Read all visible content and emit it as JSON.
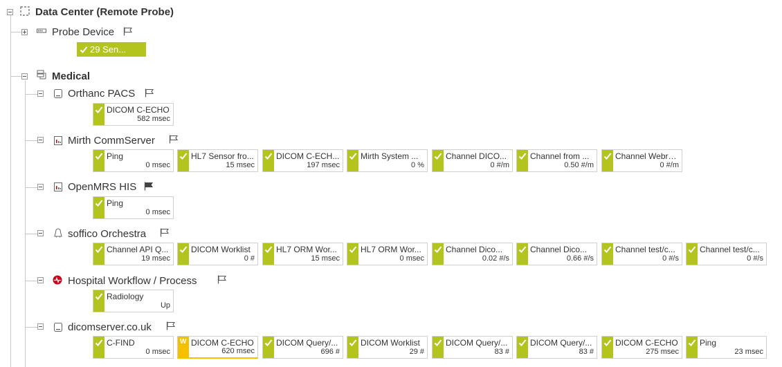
{
  "root": {
    "label": "Data Center (Remote Probe)"
  },
  "probe": {
    "label": "Probe Device",
    "summary": "29 Sen..."
  },
  "group": {
    "label": "Medical"
  },
  "devices": [
    {
      "label": "Orthanc PACS",
      "sensors": [
        {
          "name": "DICOM C-ECHO",
          "value": "582 msec",
          "status": "ok"
        }
      ]
    },
    {
      "label": "Mirth CommServer",
      "sensors": [
        {
          "name": "Ping",
          "value": "0 msec",
          "status": "ok"
        },
        {
          "name": "HL7 Sensor fro...",
          "value": "15 msec",
          "status": "ok"
        },
        {
          "name": "DICOM C-ECH...",
          "value": "197 msec",
          "status": "ok"
        },
        {
          "name": "Mirth System ...",
          "value": "0 %",
          "status": "ok"
        },
        {
          "name": "Channel DICO...",
          "value": "0 #/m",
          "status": "ok"
        },
        {
          "name": "Channel from ...",
          "value": "0.50 #/m",
          "status": "ok"
        },
        {
          "name": "Channel Webre...",
          "value": "0 #/m",
          "status": "ok"
        }
      ]
    },
    {
      "label": "OpenMRS HIS",
      "sensors": [
        {
          "name": "Ping",
          "value": "0 msec",
          "status": "ok"
        }
      ]
    },
    {
      "label": "soffico Orchestra",
      "sensors": [
        {
          "name": "Channel API Q...",
          "value": "19 msec",
          "status": "ok"
        },
        {
          "name": "DICOM Worklist",
          "value": "0 #",
          "status": "ok"
        },
        {
          "name": "HL7 ORM Wor...",
          "value": "15 msec",
          "status": "ok"
        },
        {
          "name": "HL7 ORM Wor...",
          "value": "0 msec",
          "status": "ok"
        },
        {
          "name": "Channel Dico...",
          "value": "0.02 #/s",
          "status": "ok"
        },
        {
          "name": "Channel Dico...",
          "value": "0.66 #/s",
          "status": "ok"
        },
        {
          "name": "Channel test/c...",
          "value": "0 #/s",
          "status": "ok"
        },
        {
          "name": "Channel test/c...",
          "value": "0 #/s",
          "status": "ok"
        }
      ]
    },
    {
      "label": "Hospital Workflow / Process",
      "sensors": [
        {
          "name": "Radiology",
          "value": "Up",
          "status": "ok"
        }
      ]
    },
    {
      "label": "dicomserver.co.uk",
      "sensors": [
        {
          "name": "C-FIND",
          "value": "0 msec",
          "status": "ok"
        },
        {
          "name": "DICOM C-ECHO",
          "value": "620 msec",
          "status": "warning",
          "badge": "W"
        },
        {
          "name": "DICOM Query/...",
          "value": "696 #",
          "status": "ok"
        },
        {
          "name": "DICOM Worklist",
          "value": "29 #",
          "status": "ok"
        },
        {
          "name": "DICOM Query/...",
          "value": "83 #",
          "status": "ok"
        },
        {
          "name": "DICOM Query/...",
          "value": "83 #",
          "status": "ok"
        },
        {
          "name": "DICOM C-ECHO",
          "value": "275 msec",
          "status": "ok"
        },
        {
          "name": "Ping",
          "value": "23 msec",
          "status": "ok"
        }
      ]
    }
  ],
  "colors": {
    "ok": "#b4c41e",
    "warning": "#f5c000",
    "tree_line": "#c8c8c8",
    "alert_icon": "#d0021b"
  }
}
